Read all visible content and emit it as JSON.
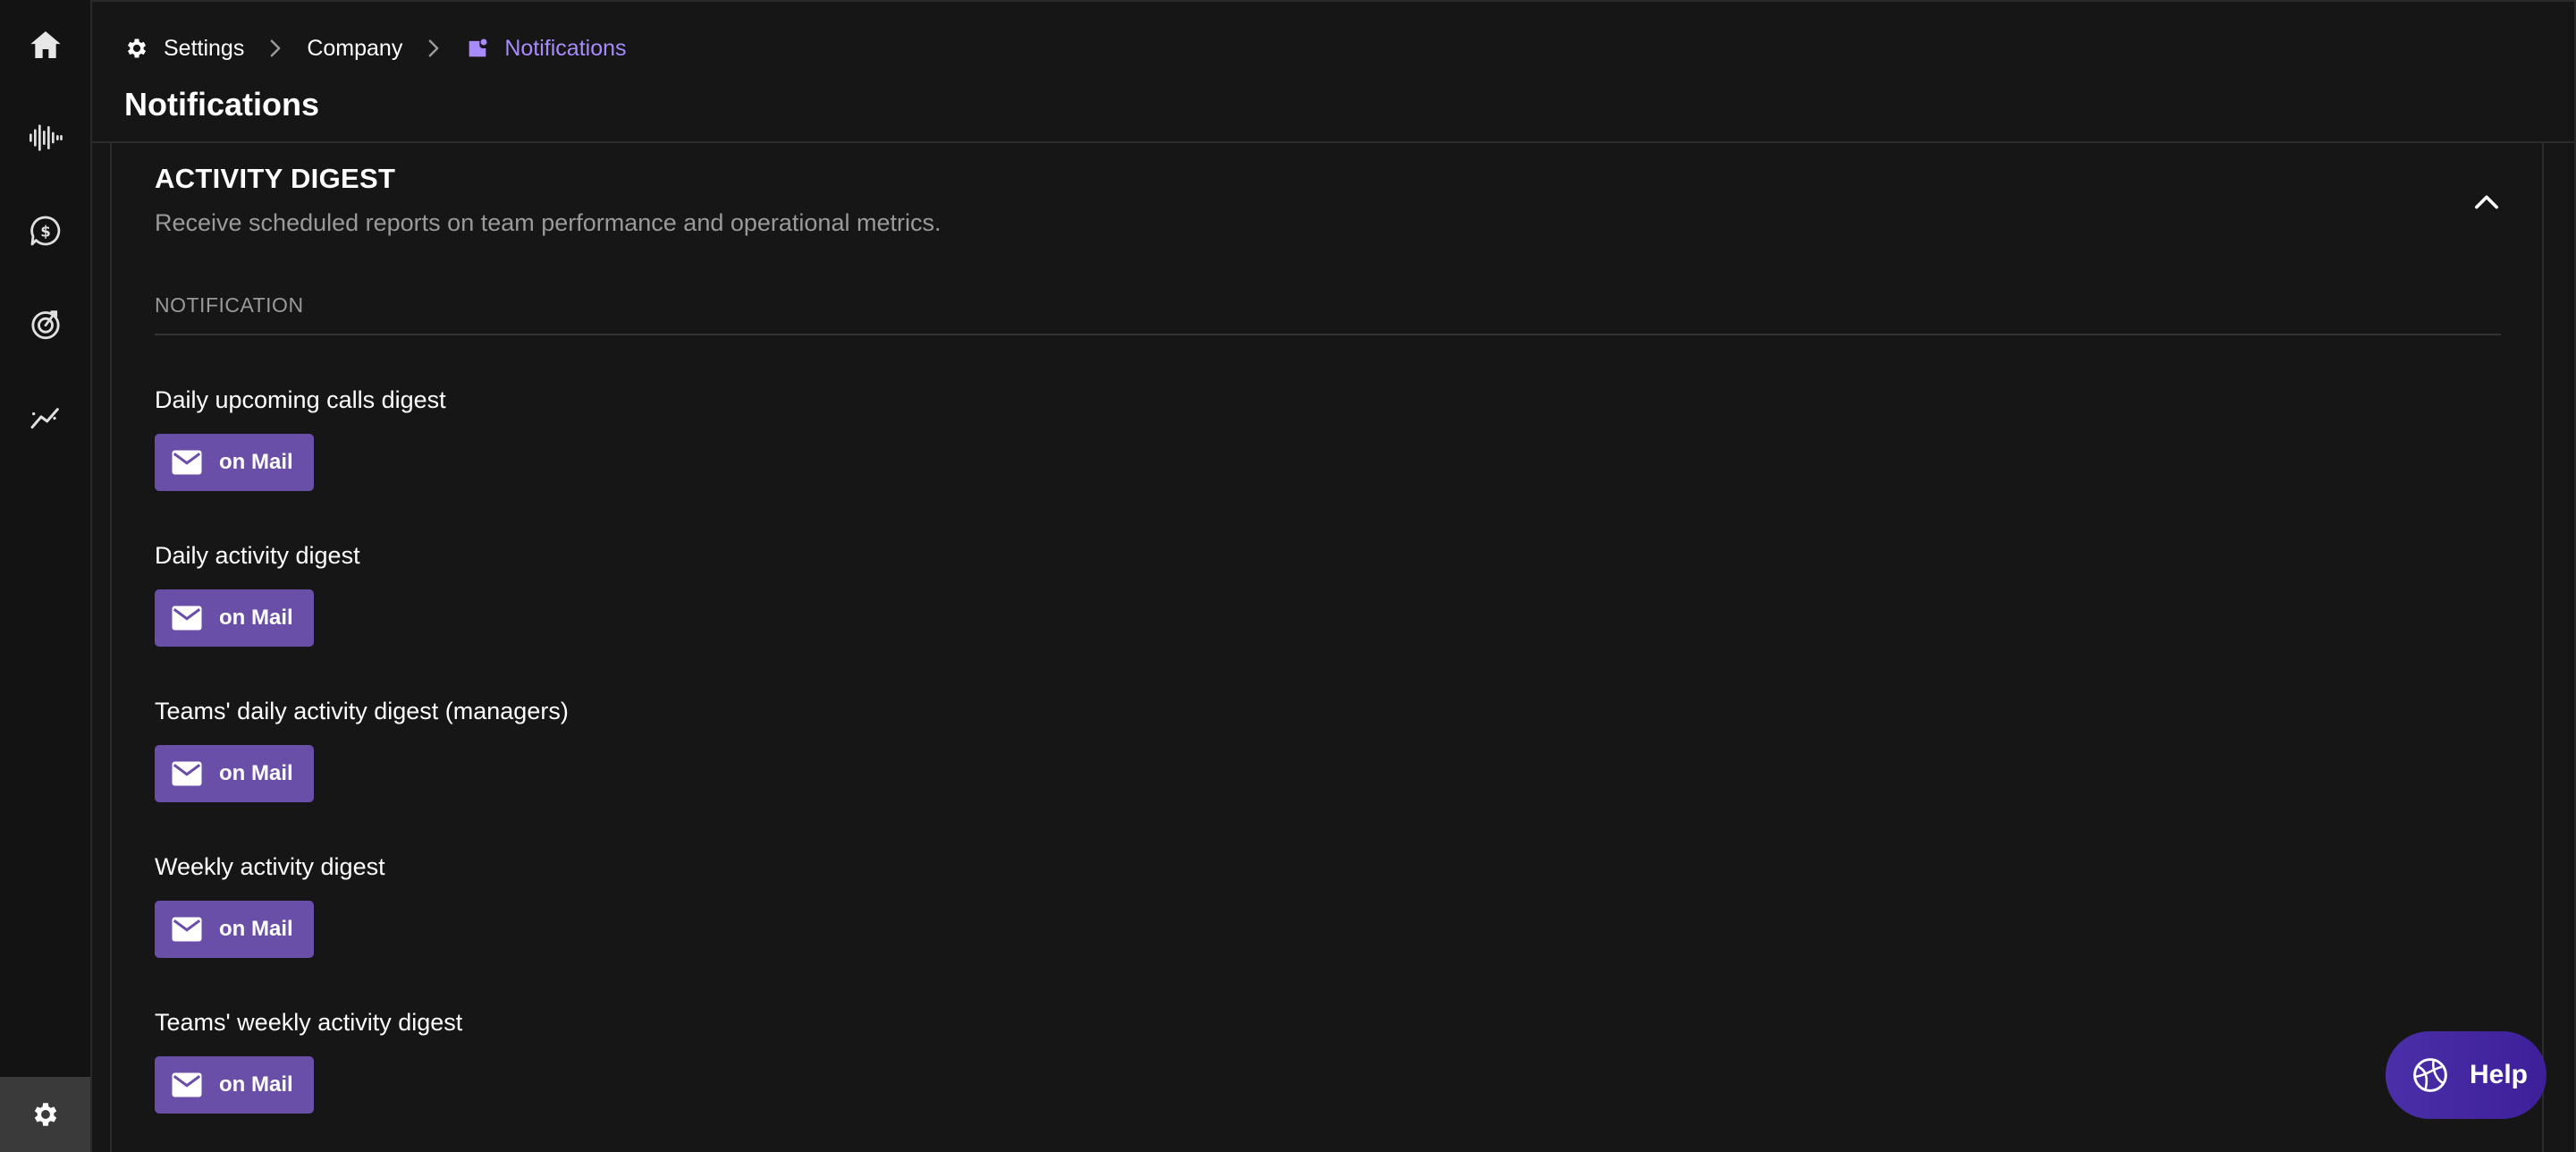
{
  "sidebar": {
    "items": [
      {
        "icon": "home-icon"
      },
      {
        "icon": "waveform-icon"
      },
      {
        "icon": "deal-dollar-icon"
      },
      {
        "icon": "target-icon"
      },
      {
        "icon": "trend-chart-icon"
      }
    ],
    "settings_icon": "gear-icon"
  },
  "breadcrumb": {
    "settings": "Settings",
    "company": "Company",
    "notifications": "Notifications"
  },
  "header": {
    "title": "Notifications"
  },
  "section": {
    "title": "ACTIVITY DIGEST",
    "description": "Receive scheduled reports on team performance and operational metrics.",
    "column_header": "NOTIFICATION"
  },
  "notifications": [
    {
      "label": "Daily upcoming calls digest",
      "button": "on Mail"
    },
    {
      "label": "Daily activity digest",
      "button": "on Mail"
    },
    {
      "label": "Teams' daily activity digest (managers)",
      "button": "on Mail"
    },
    {
      "label": "Weekly activity digest",
      "button": "on Mail"
    },
    {
      "label": "Teams' weekly activity digest",
      "button": "on Mail"
    }
  ],
  "help": {
    "label": "Help"
  },
  "colors": {
    "accent": "#a78bfa",
    "mail_button": "#6a4fa8",
    "help_button": "#4a2fa8",
    "background": "#161616"
  }
}
